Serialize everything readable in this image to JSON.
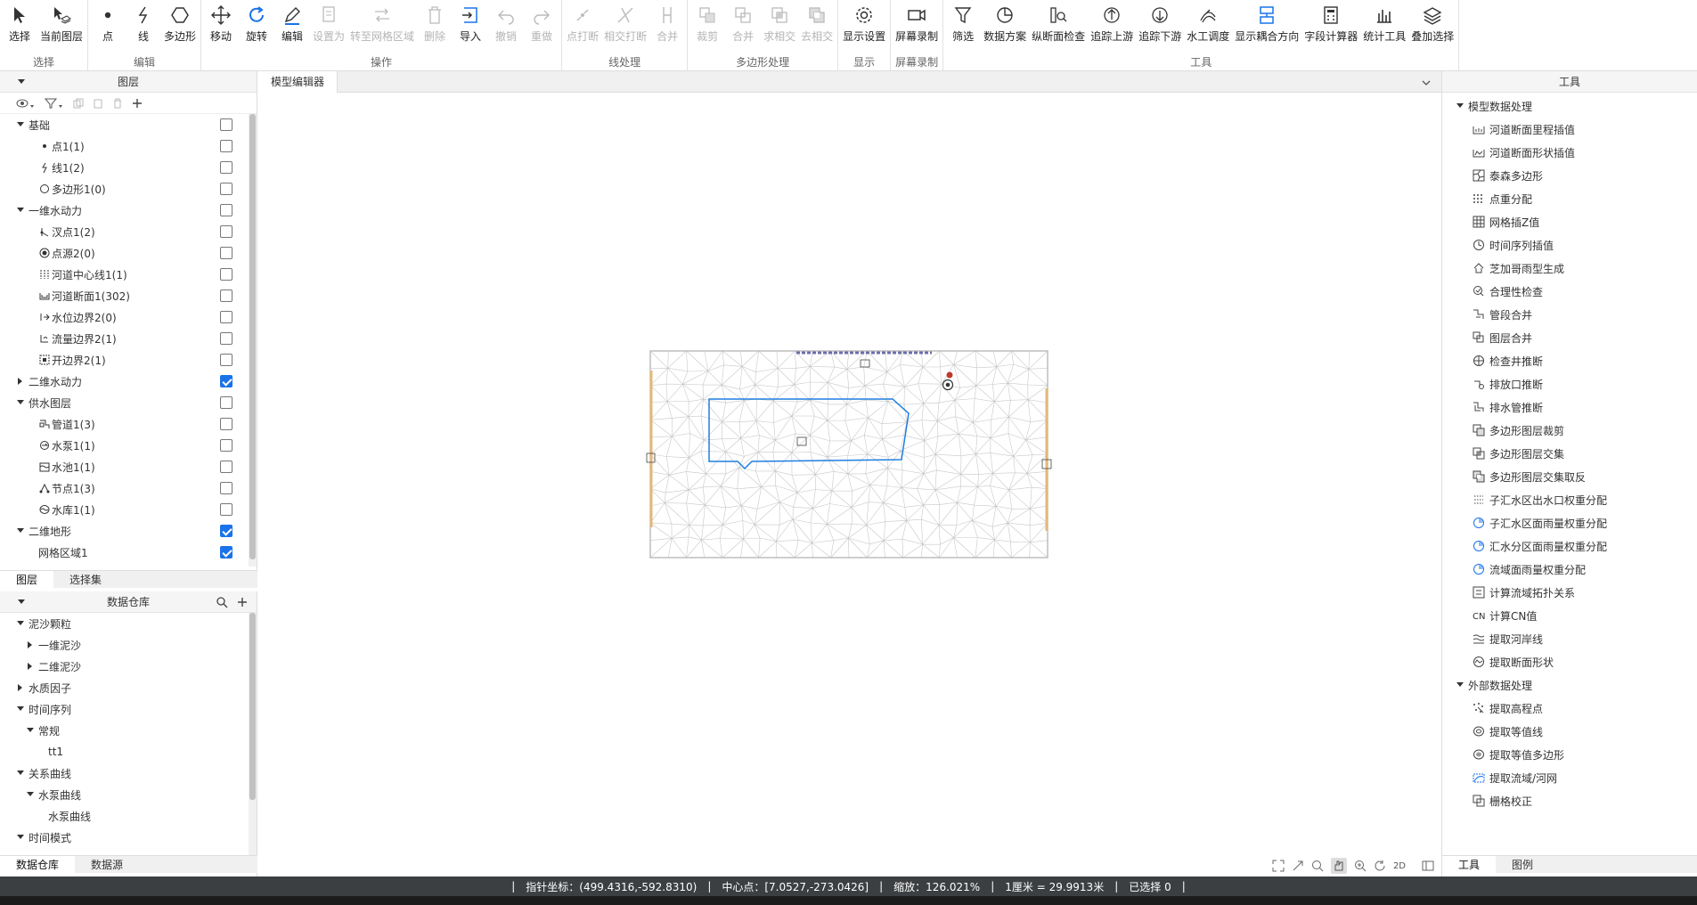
{
  "ribbon": {
    "groups": [
      {
        "title": "选择",
        "buttons": [
          {
            "label": "选择",
            "icon": "cursor-icon"
          },
          {
            "label": "当前图层",
            "icon": "cursor-layer-icon"
          }
        ]
      },
      {
        "title": "编辑",
        "buttons": [
          {
            "label": "点",
            "icon": "point-icon"
          },
          {
            "label": "线",
            "icon": "line-icon"
          },
          {
            "label": "多边形",
            "icon": "polygon-icon"
          }
        ]
      },
      {
        "title": "操作",
        "buttons": [
          {
            "label": "移动",
            "icon": "move-icon"
          },
          {
            "label": "旋转",
            "icon": "rotate-icon"
          },
          {
            "label": "编辑",
            "icon": "pencil-icon"
          },
          {
            "label": "设置为",
            "icon": "set-as-icon",
            "disabled": true
          },
          {
            "label": "转至网格区域",
            "icon": "convert-icon",
            "disabled": true
          },
          {
            "label": "删除",
            "icon": "trash-icon",
            "disabled": true
          },
          {
            "label": "导入",
            "icon": "import-icon"
          },
          {
            "label": "撤销",
            "icon": "undo-icon",
            "disabled": true
          },
          {
            "label": "重做",
            "icon": "redo-icon",
            "disabled": true
          }
        ]
      },
      {
        "title": "线处理",
        "buttons": [
          {
            "label": "点打断",
            "icon": "point-break-icon",
            "disabled": true
          },
          {
            "label": "相交打断",
            "icon": "intersect-break-icon",
            "disabled": true
          },
          {
            "label": "合并",
            "icon": "merge-line-icon",
            "disabled": true
          }
        ]
      },
      {
        "title": "多边形处理",
        "buttons": [
          {
            "label": "裁剪",
            "icon": "clip-icon",
            "disabled": true
          },
          {
            "label": "合并",
            "icon": "merge-icon",
            "disabled": true
          },
          {
            "label": "求相交",
            "icon": "intersect-icon",
            "disabled": true
          },
          {
            "label": "去相交",
            "icon": "remove-intersect-icon",
            "disabled": true
          }
        ]
      },
      {
        "title": "显示",
        "buttons": [
          {
            "label": "显示设置",
            "icon": "gear-icon"
          }
        ]
      },
      {
        "title": "屏幕录制",
        "buttons": [
          {
            "label": "屏幕录制",
            "icon": "camera-icon"
          }
        ]
      },
      {
        "title": "工具",
        "buttons": [
          {
            "label": "筛选",
            "icon": "filter-icon"
          },
          {
            "label": "数据方案",
            "icon": "pie-icon"
          },
          {
            "label": "纵断面检查",
            "icon": "profile-check-icon"
          },
          {
            "label": "追踪上游",
            "icon": "trace-up-icon"
          },
          {
            "label": "追踪下游",
            "icon": "trace-down-icon"
          },
          {
            "label": "水工调度",
            "icon": "hydraulic-icon"
          },
          {
            "label": "显示耦合方向",
            "icon": "coupling-icon"
          },
          {
            "label": "字段计算器",
            "icon": "calculator-icon"
          },
          {
            "label": "统计工具",
            "icon": "stats-icon"
          },
          {
            "label": "叠加选择",
            "icon": "layers-icon"
          }
        ]
      }
    ]
  },
  "layers_panel": {
    "title": "图层",
    "items": [
      {
        "label": "基础",
        "level": 0,
        "expand": "open",
        "checked": false
      },
      {
        "label": "点1(1)",
        "level": 1,
        "icon": "point-layer-icon",
        "checked": false
      },
      {
        "label": "线1(2)",
        "level": 1,
        "icon": "line-layer-icon",
        "checked": false
      },
      {
        "label": "多边形1(0)",
        "level": 1,
        "icon": "polygon-layer-icon",
        "checked": false
      },
      {
        "label": "一维水动力",
        "level": 0,
        "expand": "open",
        "checked": false
      },
      {
        "label": "汊点1(2)",
        "level": 1,
        "icon": "junction-icon",
        "checked": false
      },
      {
        "label": "点源2(0)",
        "level": 1,
        "icon": "point-source-icon",
        "checked": false
      },
      {
        "label": "河道中心线1(1)",
        "level": 1,
        "icon": "centerline-icon",
        "checked": false
      },
      {
        "label": "河道断面1(302)",
        "level": 1,
        "icon": "cross-section-icon",
        "checked": false
      },
      {
        "label": "水位边界2(0)",
        "level": 1,
        "icon": "water-level-boundary-icon",
        "checked": false
      },
      {
        "label": "流量边界2(1)",
        "level": 1,
        "icon": "flow-boundary-icon",
        "checked": false
      },
      {
        "label": "开边界2(1)",
        "level": 1,
        "icon": "open-boundary-icon",
        "checked": false
      },
      {
        "label": "二维水动力",
        "level": 0,
        "expand": "closed",
        "checked": true
      },
      {
        "label": "供水图层",
        "level": 0,
        "expand": "open",
        "checked": false
      },
      {
        "label": "管道1(3)",
        "level": 1,
        "icon": "pipe-icon",
        "checked": false
      },
      {
        "label": "水泵1(1)",
        "level": 1,
        "icon": "pump-icon",
        "checked": false
      },
      {
        "label": "水池1(1)",
        "level": 1,
        "icon": "tank-icon",
        "checked": false
      },
      {
        "label": "节点1(3)",
        "level": 1,
        "icon": "node-icon",
        "checked": false
      },
      {
        "label": "水库1(1)",
        "level": 1,
        "icon": "reservoir-icon",
        "checked": false
      },
      {
        "label": "二维地形",
        "level": 0,
        "expand": "open",
        "checked": true
      },
      {
        "label": "网格区域1",
        "level": 1,
        "checked": true
      }
    ],
    "tabs": [
      "图层",
      "选择集"
    ]
  },
  "data_panel": {
    "title": "数据仓库",
    "items": [
      {
        "label": "泥沙颗粒",
        "level": 0,
        "expand": "open"
      },
      {
        "label": "一维泥沙",
        "level": 1,
        "expand": "closed"
      },
      {
        "label": "二维泥沙",
        "level": 1,
        "expand": "closed"
      },
      {
        "label": "水质因子",
        "level": 0,
        "expand": "closed"
      },
      {
        "label": "时间序列",
        "level": 0,
        "expand": "open"
      },
      {
        "label": "常规",
        "level": 1,
        "expand": "open"
      },
      {
        "label": "tt1",
        "level": 2
      },
      {
        "label": "关系曲线",
        "level": 0,
        "expand": "open"
      },
      {
        "label": "水泵曲线",
        "level": 1,
        "expand": "open"
      },
      {
        "label": "水泵曲线",
        "level": 2
      },
      {
        "label": "时间模式",
        "level": 0,
        "expand": "open"
      }
    ],
    "tabs": [
      "数据仓库",
      "数据源"
    ]
  },
  "editor": {
    "tab": "模型编辑器",
    "map_tools": [
      "2D"
    ]
  },
  "tools_panel": {
    "title": "工具",
    "sections": [
      {
        "title": "模型数据处理",
        "items": [
          {
            "label": "河道断面里程插值",
            "icon": "section-mileage-icon"
          },
          {
            "label": "河道断面形状插值",
            "icon": "section-shape-icon"
          },
          {
            "label": "泰森多边形",
            "icon": "voronoi-icon"
          },
          {
            "label": "点重分配",
            "icon": "point-redistribute-icon"
          },
          {
            "label": "网格插Z值",
            "icon": "grid-z-icon"
          },
          {
            "label": "时间序列插值",
            "icon": "clock-icon"
          },
          {
            "label": "芝加哥雨型生成",
            "icon": "rain-icon"
          },
          {
            "label": "合理性检查",
            "icon": "check-icon"
          },
          {
            "label": "管段合并",
            "icon": "pipe-merge-icon"
          },
          {
            "label": "图层合并",
            "icon": "layer-merge-icon"
          },
          {
            "label": "检查井推断",
            "icon": "manhole-icon"
          },
          {
            "label": "排放口推断",
            "icon": "outfall-icon"
          },
          {
            "label": "排水管推断",
            "icon": "drain-pipe-icon"
          },
          {
            "label": "多边形图层裁剪",
            "icon": "polygon-clip-icon"
          },
          {
            "label": "多边形图层交集",
            "icon": "polygon-intersect-icon"
          },
          {
            "label": "多边形图层交集取反",
            "icon": "polygon-invert-icon"
          },
          {
            "label": "子汇水区出水口权重分配",
            "icon": "outlet-weight-icon"
          },
          {
            "label": "子汇水区面雨量权重分配",
            "icon": "sub-rain-weight-icon"
          },
          {
            "label": "汇水分区面雨量权重分配",
            "icon": "zone-rain-weight-icon"
          },
          {
            "label": "流域面雨量权重分配",
            "icon": "basin-rain-weight-icon"
          },
          {
            "label": "计算流域拓扑关系",
            "icon": "topology-icon"
          },
          {
            "label": "计算CN值",
            "icon": "cn-icon"
          },
          {
            "label": "提取河岸线",
            "icon": "bank-line-icon"
          },
          {
            "label": "提取断面形状",
            "icon": "section-extract-icon"
          }
        ]
      },
      {
        "title": "外部数据处理",
        "items": [
          {
            "label": "提取高程点",
            "icon": "elevation-point-icon"
          },
          {
            "label": "提取等值线",
            "icon": "contour-icon"
          },
          {
            "label": "提取等值多边形",
            "icon": "contour-polygon-icon"
          },
          {
            "label": "提取流域/河网",
            "icon": "river-network-icon"
          },
          {
            "label": "栅格校正",
            "icon": "raster-correct-icon"
          }
        ]
      }
    ],
    "tabs": [
      "工具",
      "图例"
    ]
  },
  "status": {
    "pointer": "指针坐标：(499.4316,-592.8310)",
    "center": "中心点：[7.0527,-273.0426]",
    "zoom": "缩放：126.021%",
    "scale": "1厘米 = 29.9913米",
    "selected": "已选择 0"
  },
  "colors": {
    "accent": "#1a73e8",
    "status_bg": "#3c3f41",
    "mesh": "#c8c8c8",
    "polygon": "#1e7fe0",
    "boundary": "#e2b978"
  }
}
